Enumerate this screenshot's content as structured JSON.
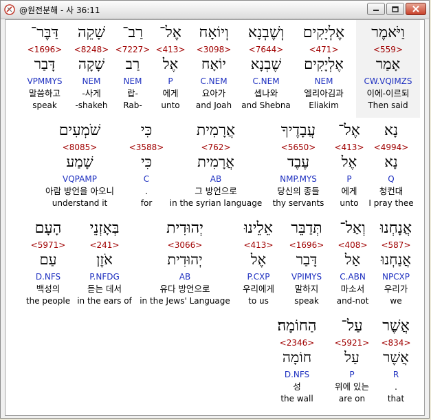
{
  "window": {
    "title": "@원전분해 - 사 36:11"
  },
  "rows": [
    {
      "words": [
        {
          "heb": "וַיֹּאמֶר",
          "num": "<559>",
          "lemma": "אָמַר",
          "parse": "CW.VQIMZS",
          "kor": "이에-이르되",
          "eng": "Then said",
          "selected": true
        },
        {
          "heb": "אֶלְיָקִים",
          "num": "<471>",
          "lemma": "אֶלְיָקִים",
          "parse": "NEM",
          "kor": "엘리아김과",
          "eng": "Eliakim"
        },
        {
          "heb": "וְשֶׁבְנָא",
          "num": "<7644>",
          "lemma": "שֶׁבְנָא",
          "parse": "C.NEM",
          "kor": "셉나와",
          "eng": "and Shebna"
        },
        {
          "heb": "וְיוֹאָח",
          "num": "<3098>",
          "lemma": "יוֹאָח",
          "parse": "C.NEM",
          "kor": "요아가",
          "eng": "and Joah"
        },
        {
          "heb": "אֶל־",
          "num": "<413>",
          "lemma": "אֶל",
          "parse": "P",
          "kor": "에게",
          "eng": "unto"
        },
        {
          "heb": "רַב־",
          "num": "<7227>",
          "lemma": "רַב",
          "parse": "NEM",
          "kor": "랍-",
          "eng": "Rab-"
        },
        {
          "heb": "שָׁקֵה",
          "num": "<8248>",
          "lemma": "שָׁקָה",
          "parse": "NEM",
          "kor": "-사게",
          "eng": "-shakeh"
        },
        {
          "heb": "דַּבֶּר־",
          "num": "<1696>",
          "lemma": "דָּבַר",
          "parse": "VPMMYS",
          "kor": "말씀하고",
          "eng": "speak"
        }
      ]
    },
    {
      "words": [
        {
          "heb": "נָא",
          "num": "<4994>",
          "lemma": "נָא",
          "parse": "Q",
          "kor": "청컨대",
          "eng": "I pray thee"
        },
        {
          "heb": "אֶל־",
          "num": "<413>",
          "lemma": "אֶל",
          "parse": "P",
          "kor": "에게",
          "eng": "unto"
        },
        {
          "heb": "עֲבָדֶיךָ",
          "num": "<5650>",
          "lemma": "עֶבֶד",
          "parse": "NMP.MYS",
          "kor": "당신의 종들",
          "eng": "thy servants"
        },
        {
          "heb": "אֲרָמִית",
          "num": "<762>",
          "lemma": "אֲרָמִית",
          "parse": "AB",
          "kor": "그 방언으로",
          "eng": "in the syrian language"
        },
        {
          "heb": "כִּי",
          "num": "<3588>",
          "lemma": "כִּי",
          "parse": "C",
          "kor": ".",
          "eng": "for"
        },
        {
          "heb": "שֹׁמְעִים",
          "num": "<8085>",
          "lemma": "שָׁמַע",
          "parse": "VQPAMP",
          "kor": "아람 방언을 아오니",
          "eng": "understand it"
        }
      ]
    },
    {
      "words": [
        {
          "heb": "אֲנָחְנוּ",
          "num": "<587>",
          "lemma": "אֲנַחְנוּ",
          "parse": "NPCXP",
          "kor": "우리가",
          "eng": "we"
        },
        {
          "heb": "וְאַל־",
          "num": "<408>",
          "lemma": "אַל",
          "parse": "C.ABN",
          "kor": "마소서",
          "eng": "and-not"
        },
        {
          "heb": "תְּדַבֵּר",
          "num": "<1696>",
          "lemma": "דָּבַר",
          "parse": "VPIMYS",
          "kor": "말하지",
          "eng": "speak"
        },
        {
          "heb": "אֵלֵינוּ",
          "num": "<413>",
          "lemma": "אֶל",
          "parse": "P.CXP",
          "kor": "우리에게",
          "eng": "to us"
        },
        {
          "heb": "יְהוּדִית",
          "num": "<3066>",
          "lemma": "יְהוּדִית",
          "parse": "AB",
          "kor": "유다 방언으로",
          "eng": "in the Jews' Language"
        },
        {
          "heb": "בְּאָזְנֵי",
          "num": "<241>",
          "lemma": "אֹזֶן",
          "parse": "P.NFDG",
          "kor": "듣는 데서",
          "eng": "in the ears of"
        },
        {
          "heb": "הָעָם",
          "num": "<5971>",
          "lemma": "עַם",
          "parse": "D.NFS",
          "kor": "백성의",
          "eng": "the people"
        }
      ]
    },
    {
      "words": [
        {
          "heb": "אֲשֶׁר",
          "num": "<834>",
          "lemma": "אֲשֶׁר",
          "parse": "R",
          "kor": ".",
          "eng": "that"
        },
        {
          "heb": "עַל־",
          "num": "<5921>",
          "lemma": "עַל",
          "parse": "P",
          "kor": "위에 있는",
          "eng": "are on"
        },
        {
          "heb": "הַחוֹמָה׃",
          "num": "<2346>",
          "lemma": "חוֹמָה",
          "parse": "D.NFS",
          "kor": "성",
          "eng": "the wall"
        }
      ]
    }
  ]
}
